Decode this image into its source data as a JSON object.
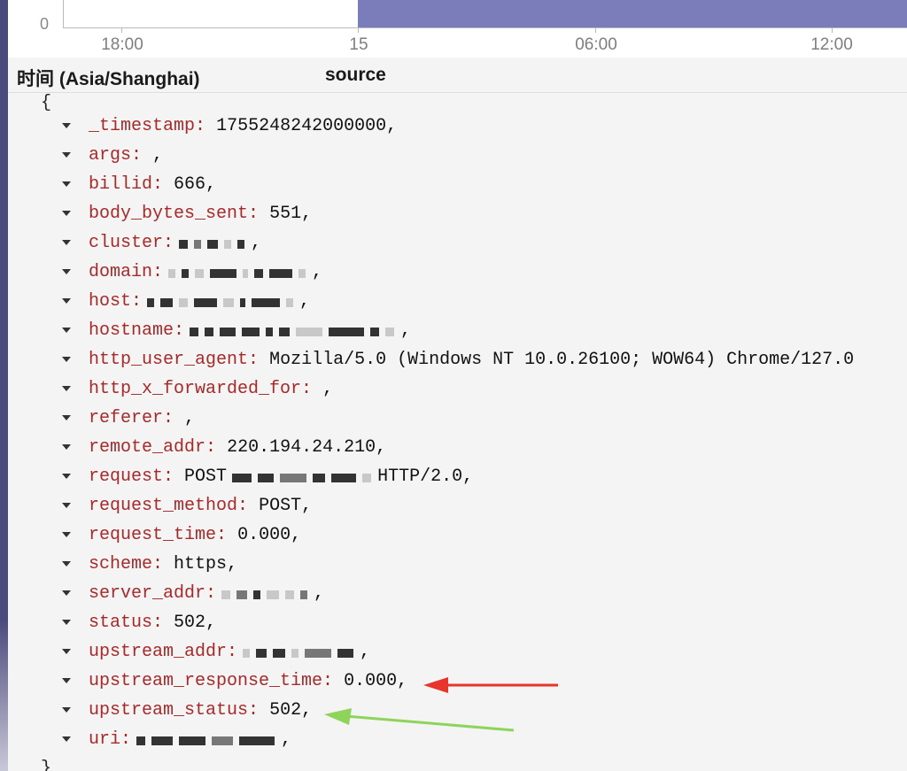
{
  "chart": {
    "y_tick": "0",
    "x_ticks": [
      "18:00",
      "15",
      "06:00",
      "12:00"
    ]
  },
  "columns": {
    "time": "时间 (Asia/Shanghai)",
    "source": "source"
  },
  "json": {
    "open_brace": "{",
    "close_brace": "}",
    "fields": [
      {
        "key": "_timestamp",
        "value": "1755248242000000",
        "masked": false
      },
      {
        "key": "args",
        "value": "",
        "masked": false
      },
      {
        "key": "billid",
        "value": "666",
        "masked": false
      },
      {
        "key": "body_bytes_sent",
        "value": "551",
        "masked": false
      },
      {
        "key": "cluster",
        "value": "",
        "masked": true
      },
      {
        "key": "domain",
        "value": "",
        "masked": true
      },
      {
        "key": "host",
        "value": "",
        "masked": true
      },
      {
        "key": "hostname",
        "value": "",
        "masked": true
      },
      {
        "key": "http_user_agent",
        "value": "Mozilla/5.0 (Windows NT 10.0.26100; WOW64)   Chrome/127.0",
        "masked": false
      },
      {
        "key": "http_x_forwarded_for",
        "value": "",
        "masked": false
      },
      {
        "key": "referer",
        "value": "",
        "masked": false
      },
      {
        "key": "remote_addr",
        "value": "220.194.24.210",
        "masked": false
      },
      {
        "key": "request",
        "value": "POST",
        "value_suffix": "HTTP/2.0",
        "masked": true
      },
      {
        "key": "request_method",
        "value": "POST",
        "masked": false
      },
      {
        "key": "request_time",
        "value": "0.000",
        "masked": false
      },
      {
        "key": "scheme",
        "value": "https",
        "masked": false
      },
      {
        "key": "server_addr",
        "value": "",
        "masked": true
      },
      {
        "key": "status",
        "value": "502",
        "masked": false
      },
      {
        "key": "upstream_addr",
        "value": "",
        "masked": true
      },
      {
        "key": "upstream_response_time",
        "value": "0.000",
        "masked": false
      },
      {
        "key": "upstream_status",
        "value": "502",
        "masked": false
      },
      {
        "key": "uri",
        "value": "",
        "masked": true
      }
    ]
  },
  "annotations": {
    "red_arrow_color": "#e8352b",
    "green_arrow_color": "#8fd45a"
  },
  "colors": {
    "key_color": "#a52a2a",
    "histogram_bar": "#7b7dba",
    "sidebar": "#4b4a7d"
  }
}
